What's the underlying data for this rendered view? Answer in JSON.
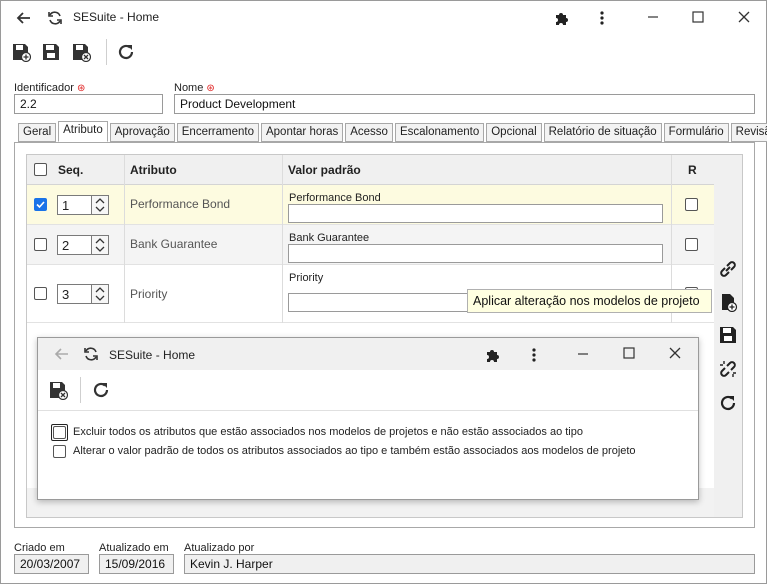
{
  "window": {
    "title": "SESuite - Home"
  },
  "form": {
    "identificador_label": "Identificador",
    "identificador_value": "2.2",
    "nome_label": "Nome",
    "nome_value": "Product Development"
  },
  "tabs": [
    {
      "label": "Geral"
    },
    {
      "label": "Atributo"
    },
    {
      "label": "Aprovação"
    },
    {
      "label": "Encerramento"
    },
    {
      "label": "Apontar horas"
    },
    {
      "label": "Acesso"
    },
    {
      "label": "Escalonamento"
    },
    {
      "label": "Opcional"
    },
    {
      "label": "Relatório de situação"
    },
    {
      "label": "Formulário"
    },
    {
      "label": "Revisão"
    }
  ],
  "grid": {
    "headers": {
      "seq": "Seq.",
      "atributo": "Atributo",
      "valor": "Valor padrão",
      "r": "R"
    },
    "rows": [
      {
        "seq": "1",
        "atributo": "Performance Bond",
        "valor_label": "Performance Bond",
        "checked": true
      },
      {
        "seq": "2",
        "atributo": "Bank Guarantee",
        "valor_label": "Bank Guarantee",
        "checked": false
      },
      {
        "seq": "3",
        "atributo": "Priority",
        "valor_label": "Priority",
        "checked": false
      }
    ]
  },
  "tooltip": "Aplicar alteração nos modelos de projeto",
  "dialog": {
    "title": "SESuite - Home",
    "option1": "Excluir todos os atributos que estão associados nos modelos de projetos e não estão associados ao tipo",
    "option2": "Alterar o valor padrão de todos os atributos associados ao tipo e também estão associados aos modelos de projeto"
  },
  "footer": {
    "criado_label": "Criado em",
    "criado_value": "20/03/2007",
    "atualizado_label": "Atualizado em",
    "atualizado_value": "15/09/2016",
    "atualizado_por_label": "Atualizado por",
    "atualizado_por_value": "Kevin J. Harper"
  },
  "colors": {
    "accent": "#1a73e8",
    "row_highlight": "#fdfbe0",
    "tooltip_bg": "#ffffe1",
    "required": "#e02020"
  }
}
